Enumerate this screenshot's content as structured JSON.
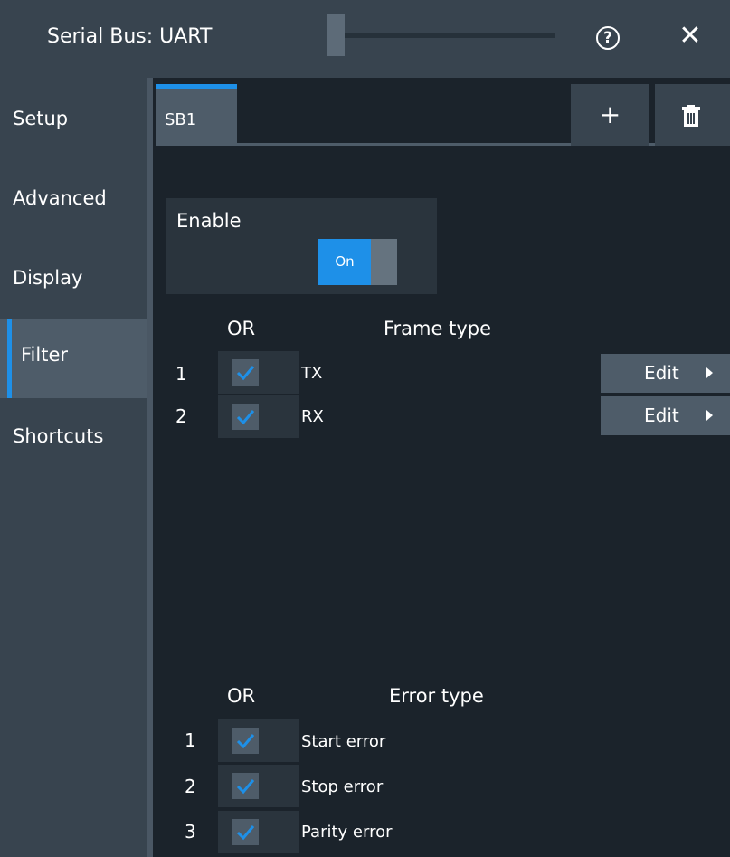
{
  "window": {
    "title": "Serial Bus: UART"
  },
  "sidebar": {
    "items": [
      {
        "label": "Setup"
      },
      {
        "label": "Advanced"
      },
      {
        "label": "Display"
      },
      {
        "label": "Filter"
      },
      {
        "label": "Shortcuts"
      }
    ],
    "active": "Filter"
  },
  "tabs": {
    "items": [
      {
        "label": "SB1"
      }
    ],
    "add_label": "+"
  },
  "enable": {
    "label": "Enable",
    "toggle_label": "On",
    "value": true
  },
  "frame_filter": {
    "or_header": "OR",
    "type_header": "Frame type",
    "rows": [
      {
        "num": "1",
        "checked": true,
        "label": "TX",
        "edit_label": "Edit"
      },
      {
        "num": "2",
        "checked": true,
        "label": "RX",
        "edit_label": "Edit"
      }
    ]
  },
  "error_filter": {
    "or_header": "OR",
    "type_header": "Error type",
    "rows": [
      {
        "num": "1",
        "checked": true,
        "label": "Start error"
      },
      {
        "num": "2",
        "checked": true,
        "label": "Stop error"
      },
      {
        "num": "3",
        "checked": true,
        "label": "Parity error"
      }
    ]
  },
  "colors": {
    "accent": "#1e90e8",
    "panel": "#38444f",
    "background": "#1b232b"
  }
}
